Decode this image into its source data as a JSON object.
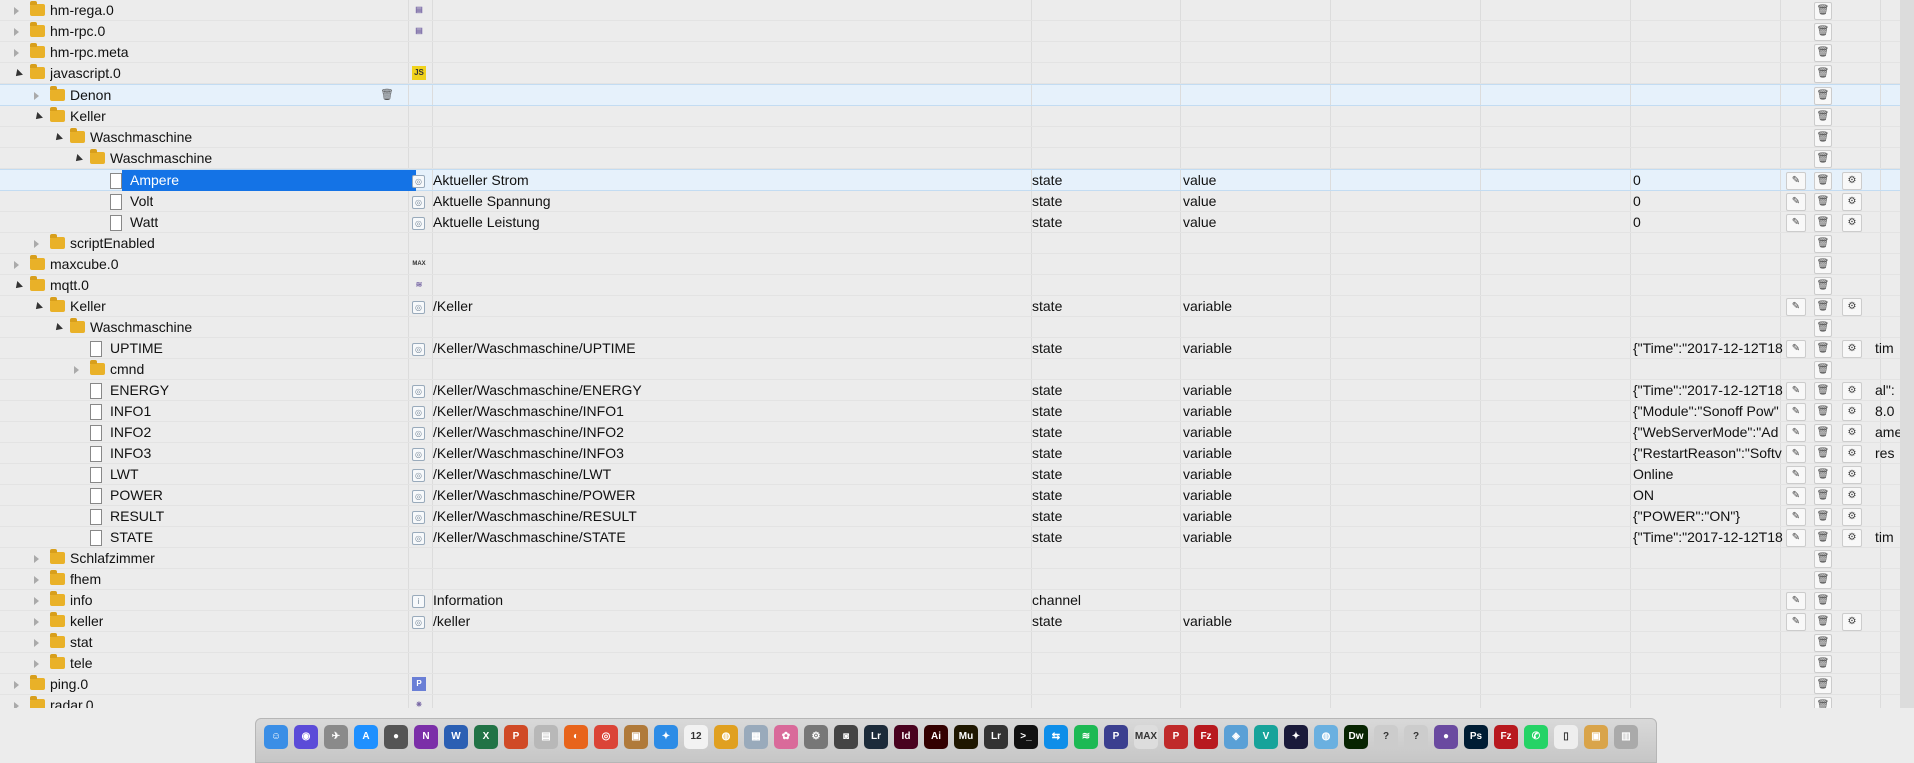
{
  "colors": {
    "selection": "#1473e6",
    "row_highlight": "#e6f1fb",
    "folder": "#e9b128"
  },
  "rows": [
    {
      "level": 0,
      "expand": "closed",
      "type": "folder",
      "name": "hm-rega.0",
      "inst_icon": "hm-rega-icon",
      "hasEdit": false,
      "hasGear": false,
      "desc": "",
      "role1": "",
      "role2": "",
      "value": "",
      "extra": ""
    },
    {
      "level": 0,
      "expand": "closed",
      "type": "folder",
      "name": "hm-rpc.0",
      "inst_icon": "hm-rpc-icon",
      "hasEdit": false,
      "hasGear": false,
      "desc": "",
      "role1": "",
      "role2": "",
      "value": "",
      "extra": ""
    },
    {
      "level": 0,
      "expand": "closed",
      "type": "folder",
      "name": "hm-rpc.meta",
      "inst_icon": "",
      "hasEdit": false,
      "hasGear": false,
      "desc": "",
      "role1": "",
      "role2": "",
      "value": "",
      "extra": ""
    },
    {
      "level": 0,
      "expand": "open",
      "type": "folder",
      "name": "javascript.0",
      "inst_icon": "js-icon",
      "hasEdit": false,
      "hasGear": false,
      "desc": "",
      "role1": "",
      "role2": "",
      "value": "",
      "extra": ""
    },
    {
      "level": 1,
      "expand": "closed",
      "type": "folder",
      "name": "Denon",
      "inst_icon": "",
      "hasEdit": false,
      "hasGear": false,
      "desc": "",
      "role1": "",
      "role2": "",
      "value": "",
      "extra": "",
      "hover": true
    },
    {
      "level": 1,
      "expand": "open",
      "type": "folder",
      "name": "Keller",
      "inst_icon": "",
      "hasEdit": false,
      "hasGear": false,
      "desc": "",
      "role1": "",
      "role2": "",
      "value": "",
      "extra": ""
    },
    {
      "level": 2,
      "expand": "open",
      "type": "folder",
      "name": "Waschmaschine",
      "inst_icon": "",
      "hasEdit": false,
      "hasGear": false,
      "desc": "",
      "role1": "",
      "role2": "",
      "value": "",
      "extra": ""
    },
    {
      "level": 3,
      "expand": "open",
      "type": "folder",
      "name": "Waschmaschine",
      "inst_icon": "",
      "hasEdit": false,
      "hasGear": false,
      "desc": "",
      "role1": "",
      "role2": "",
      "value": "",
      "extra": ""
    },
    {
      "level": 4,
      "expand": "none",
      "type": "file",
      "name": "Ampere",
      "inst_icon": "state-icon",
      "hasEdit": true,
      "hasGear": true,
      "desc": "Aktueller Strom",
      "role1": "state",
      "role2": "value",
      "value": "0",
      "extra": "",
      "selected": true
    },
    {
      "level": 4,
      "expand": "none",
      "type": "file",
      "name": "Volt",
      "inst_icon": "state-icon",
      "hasEdit": true,
      "hasGear": true,
      "desc": "Aktuelle Spannung",
      "role1": "state",
      "role2": "value",
      "value": "0",
      "extra": ""
    },
    {
      "level": 4,
      "expand": "none",
      "type": "file",
      "name": "Watt",
      "inst_icon": "state-icon",
      "hasEdit": true,
      "hasGear": true,
      "desc": "Aktuelle Leistung",
      "role1": "state",
      "role2": "value",
      "value": "0",
      "extra": ""
    },
    {
      "level": 1,
      "expand": "closed",
      "type": "folder",
      "name": "scriptEnabled",
      "inst_icon": "",
      "hasEdit": false,
      "hasGear": false,
      "desc": "",
      "role1": "",
      "role2": "",
      "value": "",
      "extra": ""
    },
    {
      "level": 0,
      "expand": "closed",
      "type": "folder",
      "name": "maxcube.0",
      "inst_icon": "max-icon",
      "hasEdit": false,
      "hasGear": false,
      "desc": "",
      "role1": "",
      "role2": "",
      "value": "",
      "extra": ""
    },
    {
      "level": 0,
      "expand": "open",
      "type": "folder",
      "name": "mqtt.0",
      "inst_icon": "mqtt-icon",
      "hasEdit": false,
      "hasGear": false,
      "desc": "",
      "role1": "",
      "role2": "",
      "value": "",
      "extra": ""
    },
    {
      "level": 1,
      "expand": "open",
      "type": "folder",
      "name": "Keller",
      "inst_icon": "state-icon",
      "hasEdit": true,
      "hasGear": true,
      "desc": "/Keller",
      "role1": "state",
      "role2": "variable",
      "value": "",
      "extra": ""
    },
    {
      "level": 2,
      "expand": "open",
      "type": "folder",
      "name": "Waschmaschine",
      "inst_icon": "",
      "hasEdit": false,
      "hasGear": false,
      "desc": "",
      "role1": "",
      "role2": "",
      "value": "",
      "extra": ""
    },
    {
      "level": 3,
      "expand": "none",
      "type": "file",
      "name": "UPTIME",
      "inst_icon": "state-icon",
      "hasEdit": true,
      "hasGear": true,
      "desc": "/Keller/Waschmaschine/UPTIME",
      "role1": "state",
      "role2": "variable",
      "value": "{\"Time\":\"2017-12-12T18",
      "extra": "tim"
    },
    {
      "level": 3,
      "expand": "closed",
      "type": "folder",
      "name": "cmnd",
      "inst_icon": "",
      "hasEdit": false,
      "hasGear": false,
      "desc": "",
      "role1": "",
      "role2": "",
      "value": "",
      "extra": ""
    },
    {
      "level": 3,
      "expand": "none",
      "type": "file",
      "name": "ENERGY",
      "inst_icon": "state-icon",
      "hasEdit": true,
      "hasGear": true,
      "desc": "/Keller/Waschmaschine/ENERGY",
      "role1": "state",
      "role2": "variable",
      "value": "{\"Time\":\"2017-12-12T18",
      "extra": "al\":"
    },
    {
      "level": 3,
      "expand": "none",
      "type": "file",
      "name": "INFO1",
      "inst_icon": "state-icon",
      "hasEdit": true,
      "hasGear": true,
      "desc": "/Keller/Waschmaschine/INFO1",
      "role1": "state",
      "role2": "variable",
      "value": "{\"Module\":\"Sonoff Pow\"",
      "extra": "8.0"
    },
    {
      "level": 3,
      "expand": "none",
      "type": "file",
      "name": "INFO2",
      "inst_icon": "state-icon",
      "hasEdit": true,
      "hasGear": true,
      "desc": "/Keller/Waschmaschine/INFO2",
      "role1": "state",
      "role2": "variable",
      "value": "{\"WebServerMode\":\"Ad",
      "extra": "ame"
    },
    {
      "level": 3,
      "expand": "none",
      "type": "file",
      "name": "INFO3",
      "inst_icon": "state-icon",
      "hasEdit": true,
      "hasGear": true,
      "desc": "/Keller/Waschmaschine/INFO3",
      "role1": "state",
      "role2": "variable",
      "value": "{\"RestartReason\":\"Softv",
      "extra": "res"
    },
    {
      "level": 3,
      "expand": "none",
      "type": "file",
      "name": "LWT",
      "inst_icon": "state-icon",
      "hasEdit": true,
      "hasGear": true,
      "desc": "/Keller/Waschmaschine/LWT",
      "role1": "state",
      "role2": "variable",
      "value": "Online",
      "extra": ""
    },
    {
      "level": 3,
      "expand": "none",
      "type": "file",
      "name": "POWER",
      "inst_icon": "state-icon",
      "hasEdit": true,
      "hasGear": true,
      "desc": "/Keller/Waschmaschine/POWER",
      "role1": "state",
      "role2": "variable",
      "value": "ON",
      "extra": ""
    },
    {
      "level": 3,
      "expand": "none",
      "type": "file",
      "name": "RESULT",
      "inst_icon": "state-icon",
      "hasEdit": true,
      "hasGear": true,
      "desc": "/Keller/Waschmaschine/RESULT",
      "role1": "state",
      "role2": "variable",
      "value": "{\"POWER\":\"ON\"}",
      "extra": ""
    },
    {
      "level": 3,
      "expand": "none",
      "type": "file",
      "name": "STATE",
      "inst_icon": "state-icon",
      "hasEdit": true,
      "hasGear": true,
      "desc": "/Keller/Waschmaschine/STATE",
      "role1": "state",
      "role2": "variable",
      "value": "{\"Time\":\"2017-12-12T18",
      "extra": "tim"
    },
    {
      "level": 1,
      "expand": "closed",
      "type": "folder",
      "name": "Schlafzimmer",
      "inst_icon": "",
      "hasEdit": false,
      "hasGear": false,
      "desc": "",
      "role1": "",
      "role2": "",
      "value": "",
      "extra": ""
    },
    {
      "level": 1,
      "expand": "closed",
      "type": "folder",
      "name": "fhem",
      "inst_icon": "",
      "hasEdit": false,
      "hasGear": false,
      "desc": "",
      "role1": "",
      "role2": "",
      "value": "",
      "extra": ""
    },
    {
      "level": 1,
      "expand": "closed",
      "type": "folder",
      "name": "info",
      "inst_icon": "info-icon",
      "hasEdit": true,
      "hasGear": false,
      "desc": "Information",
      "role1": "channel",
      "role2": "",
      "value": "",
      "extra": ""
    },
    {
      "level": 1,
      "expand": "closed",
      "type": "folder",
      "name": "keller",
      "inst_icon": "state-icon",
      "hasEdit": true,
      "hasGear": true,
      "desc": "/keller",
      "role1": "state",
      "role2": "variable",
      "value": "",
      "extra": ""
    },
    {
      "level": 1,
      "expand": "closed",
      "type": "folder",
      "name": "stat",
      "inst_icon": "",
      "hasEdit": false,
      "hasGear": false,
      "desc": "",
      "role1": "",
      "role2": "",
      "value": "",
      "extra": ""
    },
    {
      "level": 1,
      "expand": "closed",
      "type": "folder",
      "name": "tele",
      "inst_icon": "",
      "hasEdit": false,
      "hasGear": false,
      "desc": "",
      "role1": "",
      "role2": "",
      "value": "",
      "extra": ""
    },
    {
      "level": 0,
      "expand": "closed",
      "type": "folder",
      "name": "ping.0",
      "inst_icon": "ping-icon",
      "hasEdit": false,
      "hasGear": false,
      "desc": "",
      "role1": "",
      "role2": "",
      "value": "",
      "extra": ""
    },
    {
      "level": 0,
      "expand": "closed",
      "type": "folder",
      "name": "radar.0",
      "inst_icon": "radar-icon",
      "hasEdit": false,
      "hasGear": false,
      "desc": "",
      "role1": "",
      "role2": "",
      "value": "",
      "extra": ""
    }
  ],
  "inst_icon_labels": {
    "js-icon": "JS",
    "max-icon": "MAX",
    "ping-icon": "P",
    "state-icon": "◎",
    "info-icon": "i",
    "hm-rega-icon": "▤",
    "hm-rpc-icon": "▤",
    "mqtt-icon": "≋",
    "radar-icon": "✷"
  },
  "dock": {
    "apps": [
      {
        "name": "finder-icon",
        "color": "#3a8ee6",
        "label": "☺"
      },
      {
        "name": "siri-icon",
        "color": "#5b4bd8",
        "label": "◉"
      },
      {
        "name": "launchpad-icon",
        "color": "#8a8a8a",
        "label": "✈"
      },
      {
        "name": "app-store-icon",
        "color": "#1e90ff",
        "label": "A"
      },
      {
        "name": "github-icon",
        "color": "#555",
        "label": "●"
      },
      {
        "name": "onenote-icon",
        "color": "#7b2fa8",
        "label": "N"
      },
      {
        "name": "word-icon",
        "color": "#2b5fb3",
        "label": "W"
      },
      {
        "name": "excel-icon",
        "color": "#217346",
        "label": "X"
      },
      {
        "name": "powerpoint-icon",
        "color": "#d04a26",
        "label": "P"
      },
      {
        "name": "notes-icon",
        "color": "#b8b8b8",
        "label": "▤"
      },
      {
        "name": "firefox-icon",
        "color": "#e8641b",
        "label": "◐"
      },
      {
        "name": "chrome-icon",
        "color": "#db4437",
        "label": "◎"
      },
      {
        "name": "archive-icon",
        "color": "#b07a3a",
        "label": "▣"
      },
      {
        "name": "safari-icon",
        "color": "#2d8ce6",
        "label": "✦"
      },
      {
        "name": "calendar-icon",
        "color": "#f2f2f2",
        "label": "12"
      },
      {
        "name": "finder-alt-icon",
        "color": "#e0a020",
        "label": "◍"
      },
      {
        "name": "preview-icon",
        "color": "#9ab",
        "label": "▦"
      },
      {
        "name": "photos-icon",
        "color": "#d96a9a",
        "label": "✿"
      },
      {
        "name": "settings-icon",
        "color": "#777",
        "label": "⚙"
      },
      {
        "name": "camera-icon",
        "color": "#444",
        "label": "◙"
      },
      {
        "name": "lightroom-icon",
        "color": "#1c2b3a",
        "label": "Lr"
      },
      {
        "name": "indesign-icon",
        "color": "#49021f",
        "label": "Id"
      },
      {
        "name": "illustrator-icon",
        "color": "#330000",
        "label": "Ai"
      },
      {
        "name": "muse-icon",
        "color": "#1f1700",
        "label": "Mu"
      },
      {
        "name": "lrc-icon",
        "color": "#333",
        "label": "Lr"
      },
      {
        "name": "terminal-icon",
        "color": "#111",
        "label": ">_"
      },
      {
        "name": "teamviewer-icon",
        "color": "#0e8ee9",
        "label": "⇆"
      },
      {
        "name": "spotify-icon",
        "color": "#1db954",
        "label": "≋"
      },
      {
        "name": "patreon-icon",
        "color": "#3b3f8f",
        "label": "P"
      },
      {
        "name": "max-app-icon",
        "color": "#ddd",
        "label": "MAX"
      },
      {
        "name": "polar-icon",
        "color": "#c02a2a",
        "label": "P"
      },
      {
        "name": "filezilla-icon",
        "color": "#b8191f",
        "label": "Fz"
      },
      {
        "name": "network-icon",
        "color": "#5aa0d6",
        "label": "◈"
      },
      {
        "name": "vivaldi-icon",
        "color": "#17a39a",
        "label": "V"
      },
      {
        "name": "starfield-icon",
        "color": "#1a1a3a",
        "label": "✦"
      },
      {
        "name": "globe-icon",
        "color": "#6ab0e0",
        "label": "◍"
      },
      {
        "name": "dreamweaver-icon",
        "color": "#072401",
        "label": "Dw"
      },
      {
        "name": "help-icon",
        "color": "#ccc",
        "label": "?"
      },
      {
        "name": "help2-icon",
        "color": "#ccc",
        "label": "?"
      },
      {
        "name": "mqtt-fx-icon",
        "color": "#6a4aa0",
        "label": "●"
      },
      {
        "name": "photoshop-icon",
        "color": "#001d34",
        "label": "Ps"
      },
      {
        "name": "filezilla2-icon",
        "color": "#b8191f",
        "label": "Fz"
      },
      {
        "name": "whatsapp-icon",
        "color": "#25d366",
        "label": "✆"
      },
      {
        "name": "pdf-icon",
        "color": "#eee",
        "label": "▯"
      },
      {
        "name": "box-icon",
        "color": "#d9a44a",
        "label": "▣"
      },
      {
        "name": "trash-icon",
        "color": "#aaa",
        "label": "▥"
      }
    ]
  }
}
